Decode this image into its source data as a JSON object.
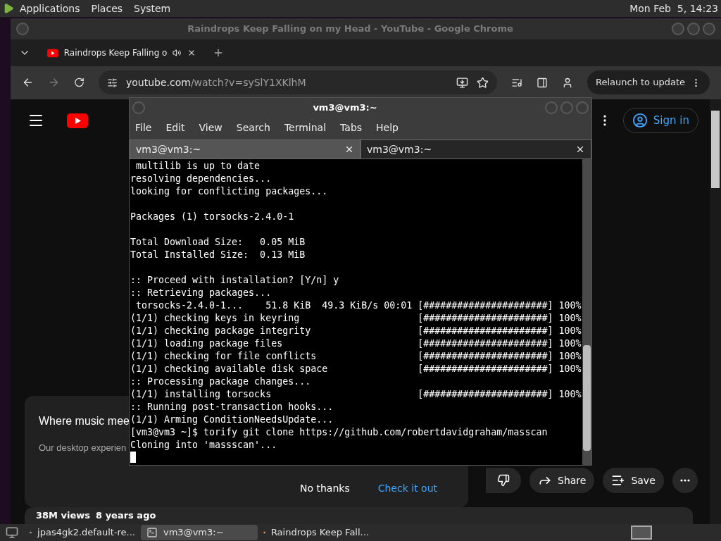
{
  "top_panel": {
    "menus": [
      "Applications",
      "Places",
      "System"
    ],
    "clock": "Mon Feb  5, 14:23"
  },
  "chrome": {
    "title": "Raindrops Keep Falling on my Head - YouTube - Google Chrome",
    "tabs": [
      {
        "title": "Raindrops Keep Falling o",
        "selected": true
      }
    ],
    "url": {
      "host": "youtube.com",
      "path": "/watch?v=sySlY1XKlhM"
    },
    "relaunch": "Relaunch to update"
  },
  "youtube": {
    "sign_in": "Sign in",
    "promo": {
      "title": "Where music mee",
      "body": "Our desktop experien",
      "buttons": [
        {
          "label": "No thanks",
          "kind": "plain"
        },
        {
          "label": "Check it out",
          "kind": "link"
        }
      ]
    },
    "actions": [
      "Share",
      "Save"
    ],
    "views": "38M views",
    "age": "8 years ago"
  },
  "terminal": {
    "title": "vm3@vm3:~",
    "menu": [
      "File",
      "Edit",
      "View",
      "Search",
      "Terminal",
      "Tabs",
      "Help"
    ],
    "tabs": [
      {
        "label": "vm3@vm3:~",
        "selected": true
      },
      {
        "label": "vm3@vm3:~",
        "selected": false
      }
    ],
    "blocks": [
      [
        " multilib is up to date",
        "resolving dependencies...",
        "looking for conflicting packages..."
      ],
      [
        "Packages (1) torsocks-2.4.0-1"
      ],
      [
        "Total Download Size:   0.05 MiB",
        "Total Installed Size:  0.13 MiB"
      ],
      [
        ":: Proceed with installation? [Y/n] y",
        ":: Retrieving packages...",
        " torsocks-2.4.0-1...    51.8 KiB  49.3 KiB/s 00:01 [######################] 100%",
        "(1/1) checking keys in keyring                     [######################] 100%",
        "(1/1) checking package integrity                   [######################] 100%",
        "(1/1) loading package files                        [######################] 100%",
        "(1/1) checking for file conflicts                  [######################] 100%",
        "(1/1) checking available disk space                [######################] 100%",
        ":: Processing package changes...",
        "(1/1) installing torsocks                          [######################] 100%",
        ":: Running post-transaction hooks...",
        "(1/1) Arming ConditionNeedsUpdate...",
        "[vm3@vm3 ~]$ torify git clone https://github.com/robertdavidgraham/masscan",
        "Cloning into 'massscan'..."
      ]
    ]
  },
  "taskbar": {
    "items": [
      {
        "label": "jpas4gk2.default-re...",
        "kind": "folder",
        "selected": false
      },
      {
        "label": "vm3@vm3:~",
        "kind": "terminal",
        "selected": true
      },
      {
        "label": "Raindrops Keep Fall...",
        "kind": "browser",
        "selected": false
      }
    ]
  }
}
